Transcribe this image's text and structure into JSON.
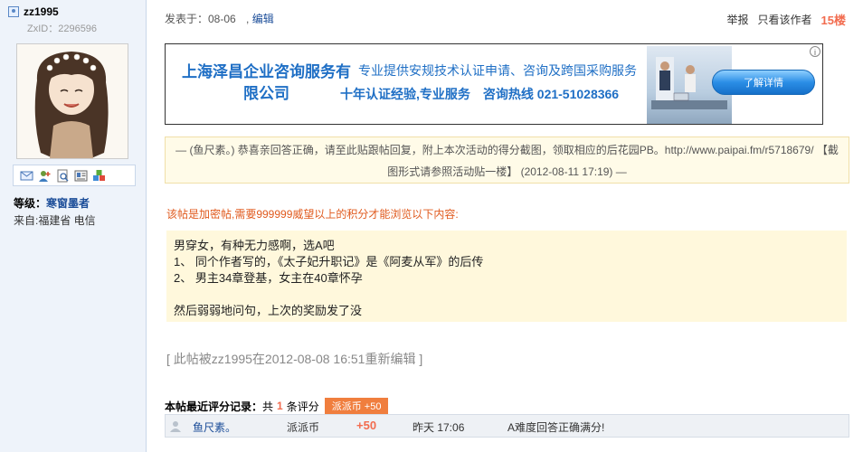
{
  "user": {
    "name": "zz1995",
    "zxid": "ZxID：2296596",
    "level_label": "等级：",
    "level_value": "寒窗墨者",
    "from": "来自:福建省 电信"
  },
  "post": {
    "meta": "发表于：08-06",
    "edit_label": "编辑",
    "report_label": "举报",
    "only_author_label": "只看该作者",
    "floor": "15楼"
  },
  "ad": {
    "company": "上海泽昌企业咨询服务有限公司",
    "line1": "专业提供安规技术认证申请、咨询及跨国采购服务",
    "line2": "十年认证经验,专业服务　咨询热线 021-51028366",
    "button_label": "了解详情",
    "info_glyph": "i"
  },
  "notice": {
    "text": "— (鱼尺素。) 恭喜亲回答正确，请至此贴跟帖回复，附上本次活动的得分截图，领取相应的后花园PB。http://www.paipai.fm/r5718679/ 【截图形式请参照活动贴一楼】 (2012-08-11 17:19) —"
  },
  "locked_text": "该帖是加密帖,需要999999威望以上的积分才能浏览以下内容:",
  "content": {
    "lines": [
      "男穿女，有种无力感啊，选A吧",
      "1、 同个作者写的，《太子妃升职记》是《阿麦从军》的后传",
      "2、 男主34章登基，女主在40章怀孕",
      "",
      "然后弱弱地问句，上次的奖励发了没"
    ]
  },
  "edited_text": "[ 此帖被zz1995在2012-08-08 16:51重新编辑 ]",
  "rating": {
    "title": "本帖最近评分记录：",
    "count_prefix": "共",
    "count": "1",
    "count_suffix": "条评分",
    "badge": "派派币 +50",
    "row": {
      "user": "鱼尺素。",
      "currency": "派派币",
      "score": "+50",
      "time": "昨天 17:06",
      "reason": "A难度回答正确满分!"
    }
  },
  "colors": {
    "link": "#1a4c98",
    "accent": "#f26c4f",
    "warning": "#e05a1e",
    "ad_blue": "#1f6fc5"
  }
}
